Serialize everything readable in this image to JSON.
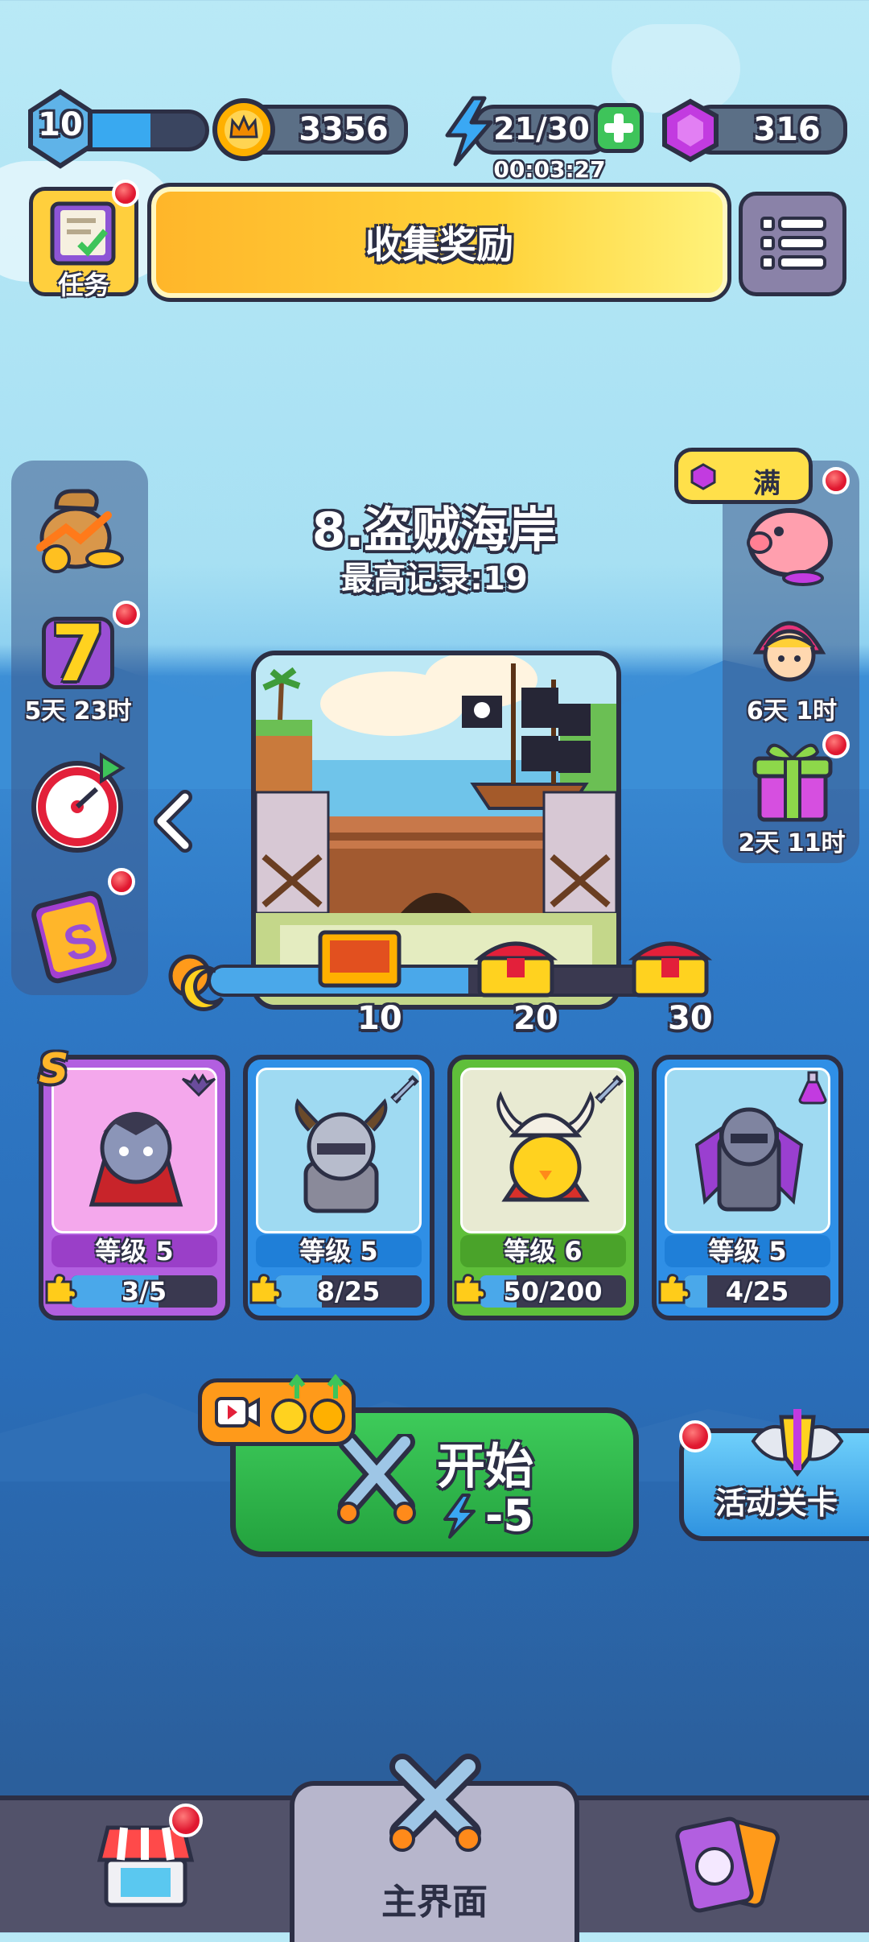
{
  "top_bar": {
    "level": "10",
    "level_progress": 0.6,
    "coins": "3356",
    "energy": "21/30",
    "energy_timer": "00:03:27",
    "gems": "316"
  },
  "tasks_label": "任务",
  "collect_reward_label": "收集奖励",
  "stage": {
    "title": "8.盗贼海岸",
    "best_record": "最高记录:19"
  },
  "left_panel": {
    "seven_day_timer": "5天 23时",
    "seven_day_number": "7"
  },
  "right_panel": {
    "piggy_label": "满",
    "hero_event_timer": "6天 1时",
    "gift_timer": "2天 11时"
  },
  "milestones": [
    {
      "value": "10"
    },
    {
      "value": "20"
    },
    {
      "value": "30"
    }
  ],
  "milestone_progress": 0.55,
  "heroes": [
    {
      "level_label": "等级 5",
      "progress_text": "3/5",
      "progress": 0.6,
      "rank": "S"
    },
    {
      "level_label": "等级 5",
      "progress_text": "8/25",
      "progress": 0.32
    },
    {
      "level_label": "等级 6",
      "progress_text": "50/200",
      "progress": 0.25
    },
    {
      "level_label": "等级 5",
      "progress_text": "4/25",
      "progress": 0.16
    }
  ],
  "start_button": {
    "label": "开始",
    "cost": "-5"
  },
  "event_stage_label": "活动关卡",
  "bottom_nav": {
    "main_label": "主界面"
  },
  "colors": {
    "collect_yellow": "#ffcc2e",
    "start_green": "#2fb34a",
    "gem_purple": "#c23be0",
    "coin_gold": "#ffb000"
  }
}
